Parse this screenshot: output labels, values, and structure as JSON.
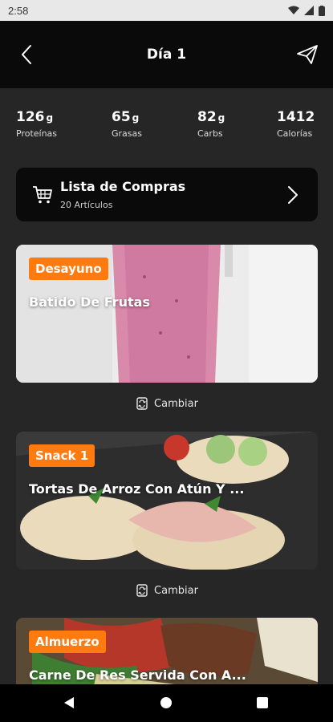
{
  "status_bar": {
    "time": "2:58"
  },
  "header": {
    "title": "Día 1"
  },
  "macros": [
    {
      "value": "126",
      "unit": "g",
      "label": "Proteínas"
    },
    {
      "value": "65",
      "unit": "g",
      "label": "Grasas"
    },
    {
      "value": "82",
      "unit": "g",
      "label": "Carbs"
    },
    {
      "value": "1412",
      "unit": "",
      "label": "Calorías"
    }
  ],
  "shopping_list": {
    "title": "Lista de Compras",
    "subtitle": "20 Artículos"
  },
  "meals": [
    {
      "badge": "Desayuno",
      "name": "Batido De Frutas"
    },
    {
      "badge": "Snack 1",
      "name": "Tortas De Arroz Con Atún Y ..."
    },
    {
      "badge": "Almuerzo",
      "name": "Carne De Res Servida Con A..."
    }
  ],
  "swap_label": "Cambiar",
  "colors": {
    "accent": "#ff7a0f",
    "background": "#262626",
    "header": "#0a0a0a"
  },
  "icons": [
    "back-arrow-icon",
    "send-icon",
    "cart-icon",
    "chevron-right-icon",
    "swap-icon"
  ]
}
